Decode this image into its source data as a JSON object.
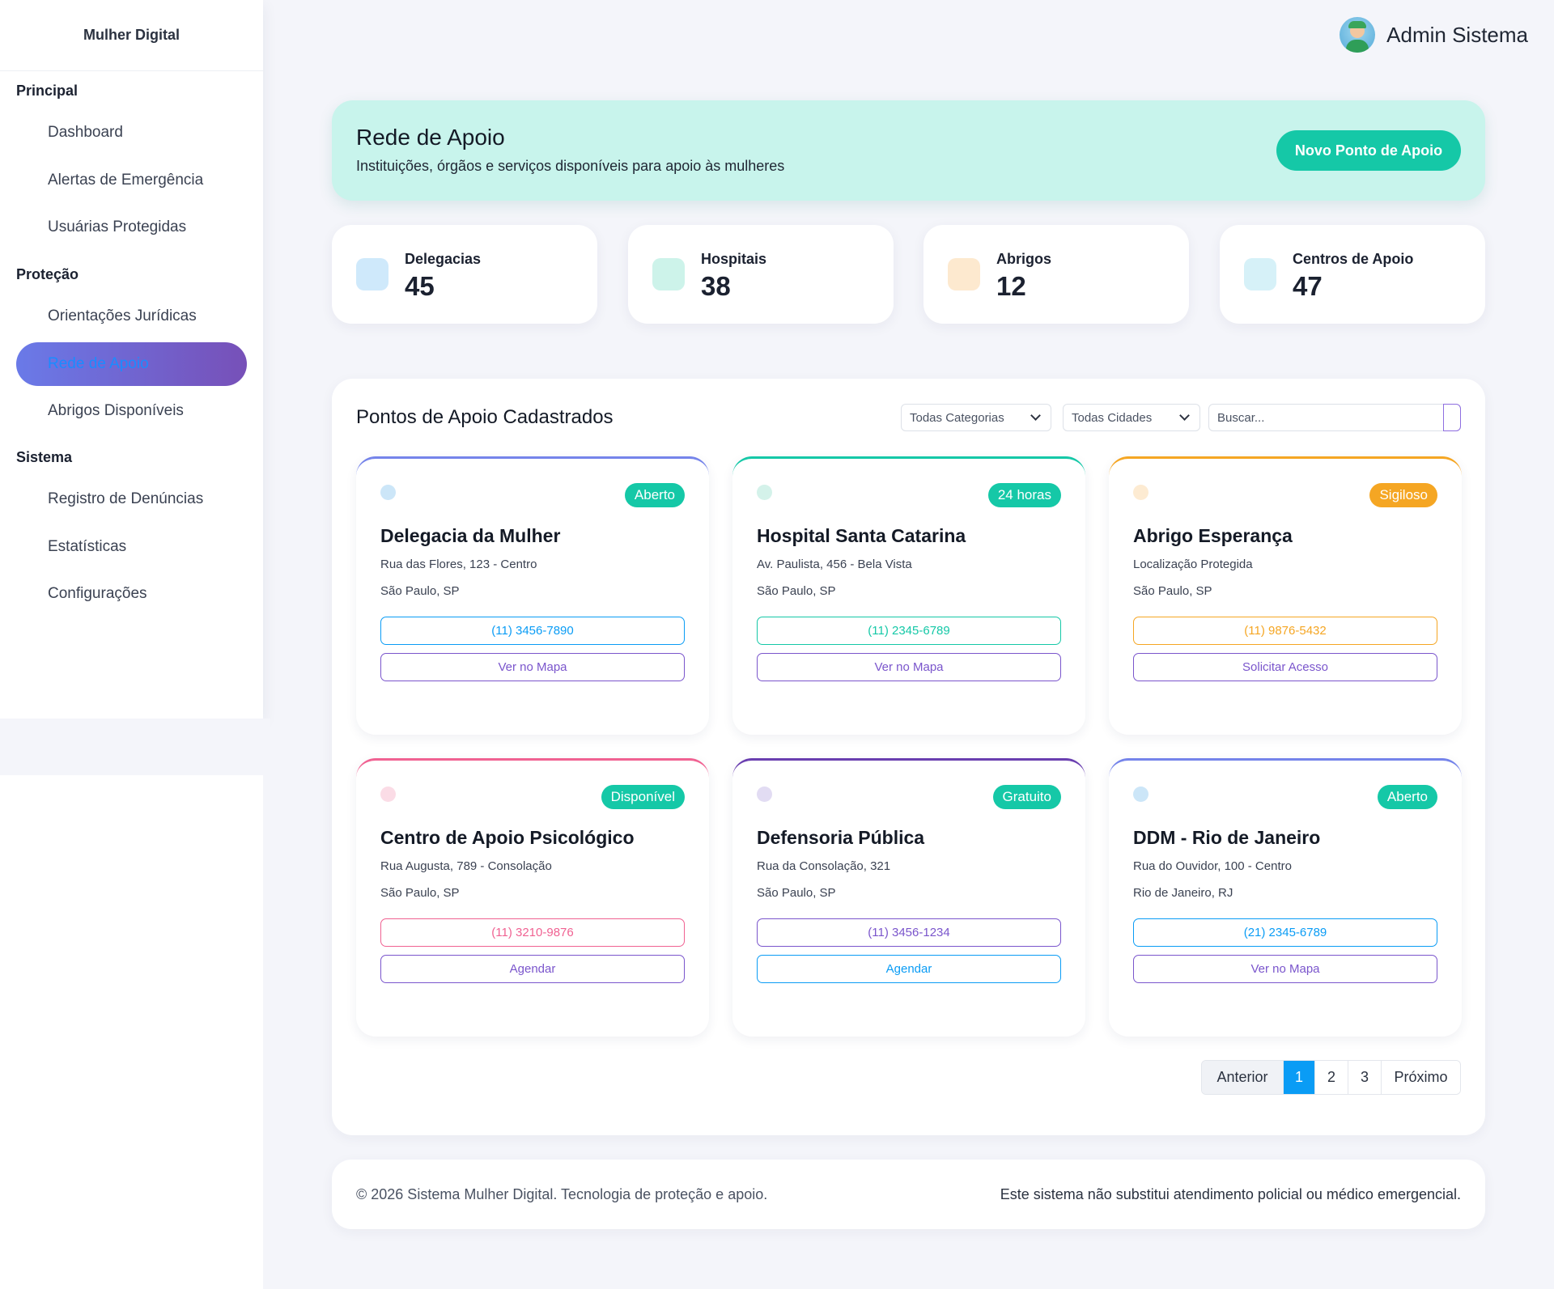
{
  "brand": "Mulher Digital",
  "user": {
    "name": "Admin Sistema"
  },
  "sidebar": {
    "sections": [
      {
        "title": "Principal",
        "items": [
          "Dashboard",
          "Alertas de Emergência",
          "Usuárias Protegidas"
        ]
      },
      {
        "title": "Proteção",
        "items": [
          "Orientações Jurídicas",
          "Rede de Apoio",
          "Abrigos Disponíveis"
        ]
      },
      {
        "title": "Sistema",
        "items": [
          "Registro de Denúncias",
          "Estatísticas",
          "Configurações"
        ]
      }
    ],
    "active_item": "Rede de Apoio"
  },
  "hero": {
    "title": "Rede de Apoio",
    "subtitle": "Instituições, órgãos e serviços disponíveis para apoio às mulheres",
    "button": "Novo Ponto de Apoio"
  },
  "stats": [
    {
      "label": "Delegacias",
      "value": "45",
      "color": "#cfe9fb"
    },
    {
      "label": "Hospitais",
      "value": "38",
      "color": "#cdf3ea"
    },
    {
      "label": "Abrigos",
      "value": "12",
      "color": "#fde9cf"
    },
    {
      "label": "Centros de Apoio",
      "value": "47",
      "color": "#d6f1f8"
    }
  ],
  "list": {
    "title": "Pontos de Apoio Cadastrados",
    "filter_category": "Todas Categorias",
    "filter_city": "Todas Cidades",
    "search_placeholder": "Buscar..."
  },
  "cards": [
    {
      "title": "Delegacia da Mulher",
      "address": "Rua das Flores, 123 - Centro",
      "city": "São Paulo, SP",
      "badge": "Aberto",
      "badge_color": "#15c8a7",
      "accent": "#7584ea",
      "dot": "#cce6f8",
      "phone": "(11) 3456-7890",
      "phone_color": "#0a9cf5",
      "action": "Ver no Mapa",
      "action_color": "#7a55cc"
    },
    {
      "title": "Hospital Santa Catarina",
      "address": "Av. Paulista, 456 - Bela Vista",
      "city": "São Paulo, SP",
      "badge": "24 horas",
      "badge_color": "#15c8a7",
      "accent": "#15c8a7",
      "dot": "#d4f2ea",
      "phone": "(11) 2345-6789",
      "phone_color": "#15c8a7",
      "action": "Ver no Mapa",
      "action_color": "#7a55cc"
    },
    {
      "title": "Abrigo Esperança",
      "address": "Localização Protegida",
      "city": "São Paulo, SP",
      "badge": "Sigiloso",
      "badge_color": "#f5a623",
      "accent": "#f5a623",
      "dot": "#fdebd2",
      "phone": "(11) 9876-5432",
      "phone_color": "#f5a623",
      "action": "Solicitar Acesso",
      "action_color": "#7a55cc"
    },
    {
      "title": "Centro de Apoio Psicológico",
      "address": "Rua Augusta, 789 - Consolação",
      "city": "São Paulo, SP",
      "badge": "Disponível",
      "badge_color": "#15c8a7",
      "accent": "#f06292",
      "dot": "#fbdce6",
      "phone": "(11) 3210-9876",
      "phone_color": "#f06292",
      "action": "Agendar",
      "action_color": "#7a55cc"
    },
    {
      "title": "Defensoria Pública",
      "address": "Rua da Consolação, 321",
      "city": "São Paulo, SP",
      "badge": "Gratuito",
      "badge_color": "#15c8a7",
      "accent": "#6a3fb0",
      "dot": "#e2dcf3",
      "phone": "(11) 3456-1234",
      "phone_color": "#7a55cc",
      "action": "Agendar",
      "action_color": "#0a9cf5"
    },
    {
      "title": "DDM - Rio de Janeiro",
      "address": "Rua do Ouvidor, 100 - Centro",
      "city": "Rio de Janeiro, RJ",
      "badge": "Aberto",
      "badge_color": "#15c8a7",
      "accent": "#7584ea",
      "dot": "#cce6f8",
      "phone": "(21) 2345-6789",
      "phone_color": "#0a9cf5",
      "action": "Ver no Mapa",
      "action_color": "#7a55cc"
    }
  ],
  "pagination": {
    "prev": "Anterior",
    "pages": [
      "1",
      "2",
      "3"
    ],
    "current": "1",
    "next": "Próximo"
  },
  "footer": {
    "left": "© 2026 Sistema Mulher Digital. Tecnologia de proteção e apoio.",
    "right": "Este sistema não substitui atendimento policial ou médico emergencial."
  }
}
